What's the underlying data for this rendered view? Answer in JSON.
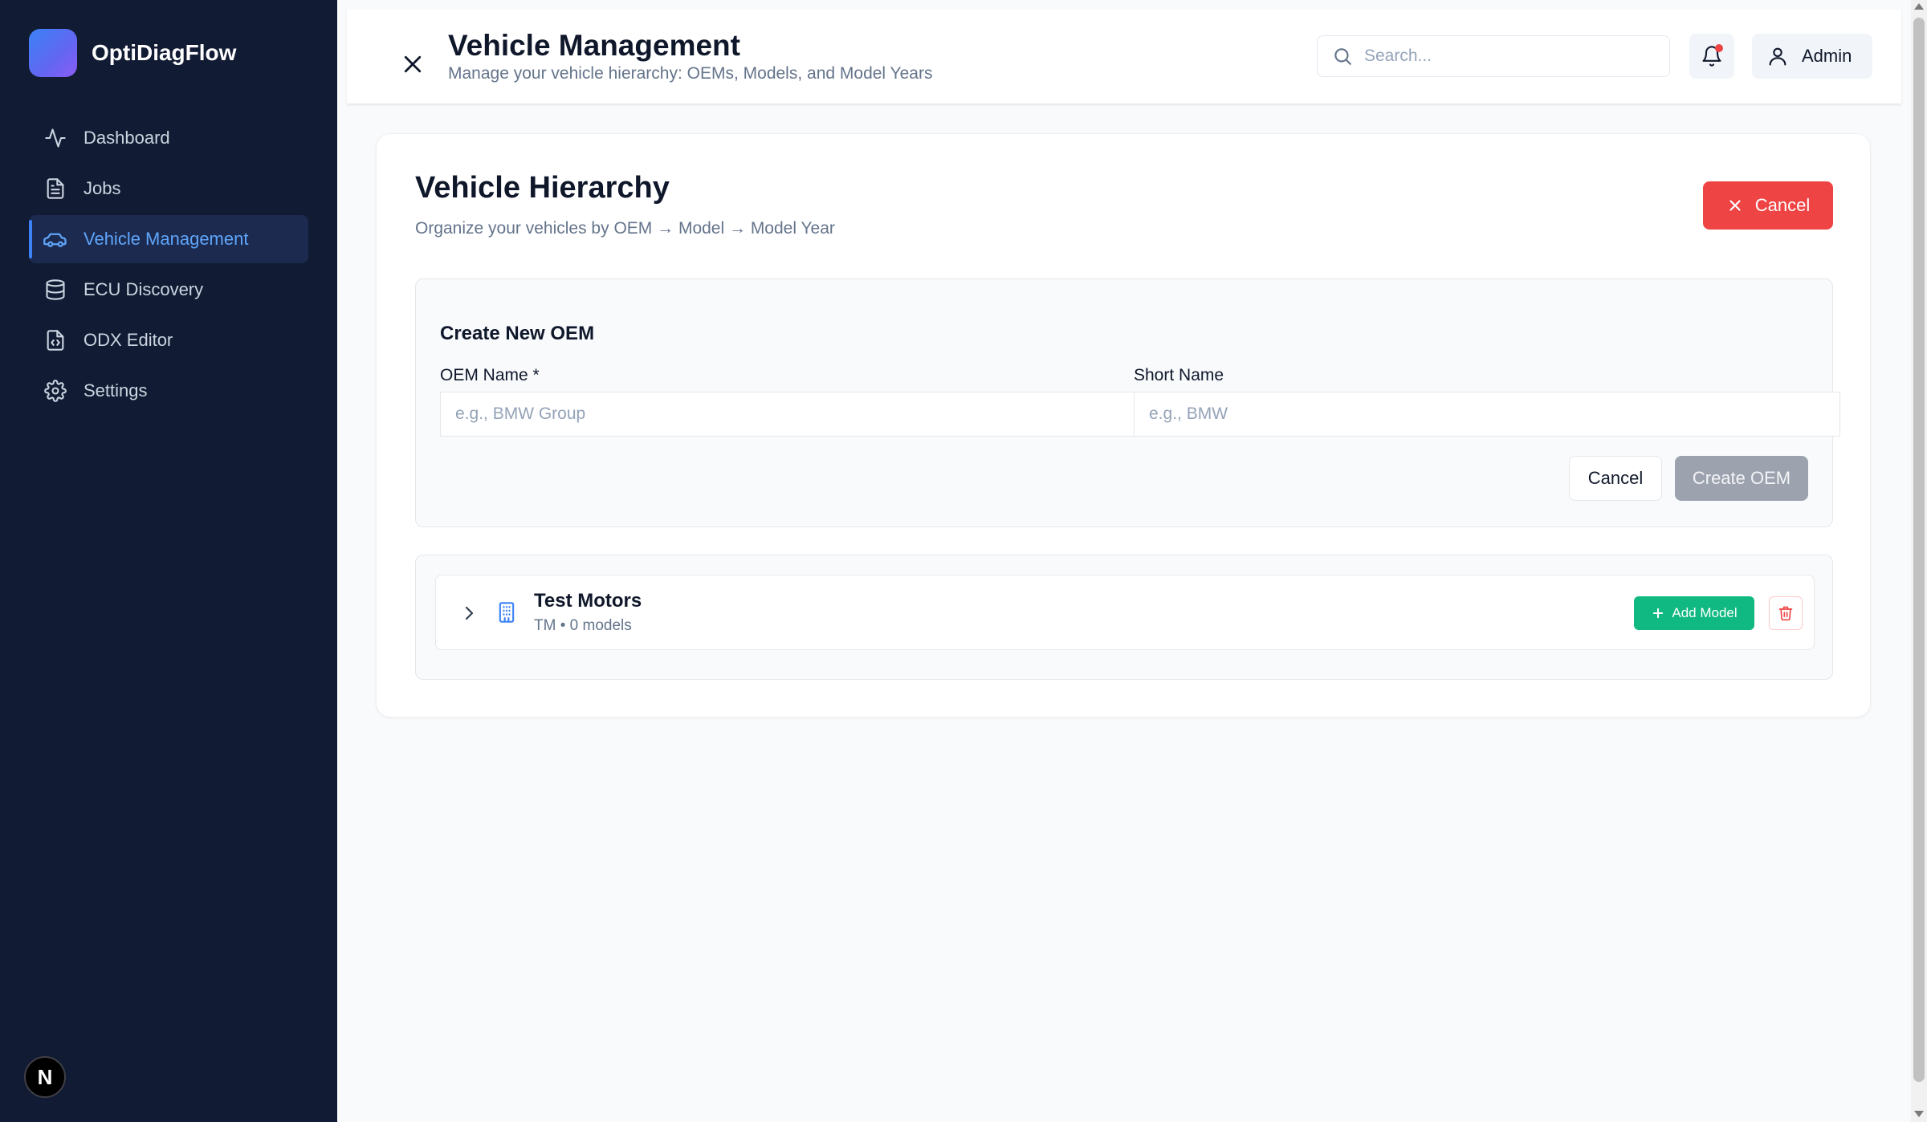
{
  "app": {
    "name": "OptiDiagFlow",
    "avatar_initial": "N"
  },
  "sidebar": {
    "items": [
      {
        "label": "Dashboard",
        "icon": "activity-icon",
        "active": false
      },
      {
        "label": "Jobs",
        "icon": "document-icon",
        "active": false
      },
      {
        "label": "Vehicle Management",
        "icon": "car-icon",
        "active": true
      },
      {
        "label": "ECU Discovery",
        "icon": "database-icon",
        "active": false
      },
      {
        "label": "ODX Editor",
        "icon": "code-file-icon",
        "active": false
      },
      {
        "label": "Settings",
        "icon": "gear-icon",
        "active": false
      }
    ]
  },
  "header": {
    "title": "Vehicle Management",
    "subtitle": "Manage your vehicle hierarchy: OEMs, Models, and Model Years",
    "search_placeholder": "Search...",
    "user_label": "Admin"
  },
  "hierarchy": {
    "title": "Vehicle Hierarchy",
    "subtitle": "Organize your vehicles by OEM → Model → Model Year",
    "cancel_label": "Cancel"
  },
  "create_oem": {
    "title": "Create New OEM",
    "oem_name_label": "OEM Name *",
    "oem_name_placeholder": "e.g., BMW Group",
    "oem_name_value": "",
    "short_name_label": "Short Name",
    "short_name_placeholder": "e.g., BMW",
    "short_name_value": "",
    "cancel_label": "Cancel",
    "create_label": "Create OEM"
  },
  "oems": [
    {
      "name": "Test Motors",
      "meta": "TM • 0 models",
      "add_model_label": "Add Model"
    }
  ],
  "colors": {
    "sidebar_bg": "#111b33",
    "accent": "#3b82f6",
    "danger": "#ef4444",
    "success": "#10b981",
    "disabled": "#9ca3af"
  }
}
